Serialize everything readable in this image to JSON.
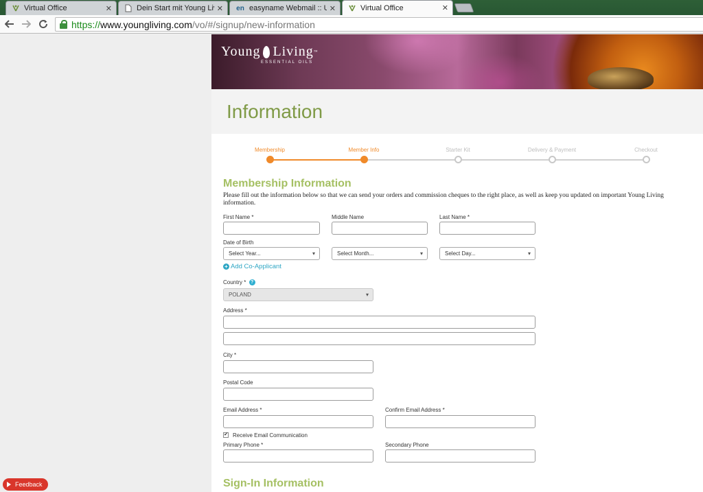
{
  "browser": {
    "tabs": [
      {
        "title": "Virtual Office",
        "icon": "young-living-favicon"
      },
      {
        "title": "Dein Start mit Young Livin",
        "icon": "page-favicon"
      },
      {
        "title": "easyname Webmail :: Utw",
        "icon": "easyname-favicon",
        "icon_text": "en"
      },
      {
        "title": "Virtual Office",
        "icon": "young-living-favicon",
        "active": true
      }
    ],
    "url": {
      "scheme": "https://",
      "host": "www.youngliving.com",
      "path": "/vo/#/signup/new-information"
    }
  },
  "banner": {
    "logo_main_left": "Young",
    "logo_main_right": "Living",
    "logo_tm": "™",
    "logo_sub": "ESSENTIAL OILS"
  },
  "page": {
    "title": "Information"
  },
  "steps": [
    {
      "label": "Membership",
      "done": true
    },
    {
      "label": "Member Info",
      "done": true
    },
    {
      "label": "Starter Kit",
      "done": false
    },
    {
      "label": "Delivery & Payment",
      "done": false
    },
    {
      "label": "Checkout",
      "done": false
    }
  ],
  "form": {
    "title": "Membership Information",
    "description": "Please fill out the information below so that we can send your orders and commission cheques to the right place, as well as keep you updated on important Young Living information.",
    "first_name_label": "First Name *",
    "middle_name_label": "Middle Name",
    "last_name_label": "Last Name *",
    "dob_label": "Date of Birth",
    "select_year": "Select Year...",
    "select_month": "Select Month...",
    "select_day": "Select Day...",
    "add_co_applicant": "Add Co-Applicant",
    "country_label": "Country *",
    "country_value": "POLAND",
    "address_label": "Address *",
    "city_label": "City *",
    "postal_code_label": "Postal Code",
    "email_label": "Email Address *",
    "confirm_email_label": "Confirm Email Address *",
    "receive_email_label": "Receive Email Communication",
    "receive_email_checked": true,
    "primary_phone_label": "Primary Phone *",
    "secondary_phone_label": "Secondary Phone"
  },
  "signin": {
    "title": "Sign-In Information"
  },
  "feedback": {
    "label": "Feedback"
  },
  "colors": {
    "accent_orange": "#f08a2a",
    "heading_green": "#7f9a46",
    "link_blue": "#2ea6c4",
    "feedback_red": "#d9362b"
  }
}
